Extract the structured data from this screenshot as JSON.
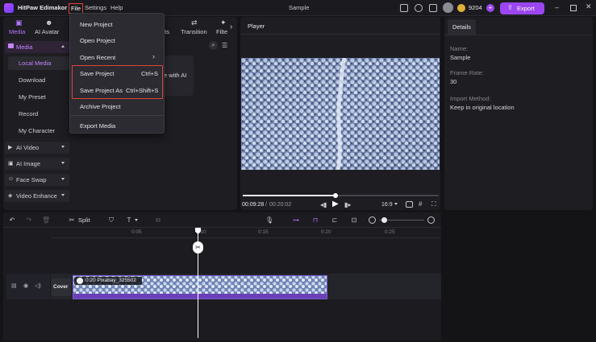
{
  "app": {
    "name": "HitPaw Edimakor",
    "window_title": "Sample",
    "credits": "9204",
    "export_label": "Export"
  },
  "menubar": {
    "file": "File",
    "settings": "Settings",
    "help": "Help"
  },
  "file_menu": {
    "items": [
      {
        "label": "New Project",
        "shortcut": ""
      },
      {
        "label": "Open Project",
        "shortcut": ""
      },
      {
        "label": "Open Recent",
        "shortcut": ""
      },
      {
        "label": "Save Project",
        "shortcut": "Ctrl+S"
      },
      {
        "label": "Save Project As",
        "shortcut": "Ctrl+Shift+S"
      },
      {
        "label": "Archive Project",
        "shortcut": ""
      },
      {
        "label": "Export Media",
        "shortcut": ""
      }
    ]
  },
  "top_tabs": [
    {
      "label": "Media",
      "icon": "media-icon"
    },
    {
      "label": "AI Avatar",
      "icon": "avatar-icon"
    },
    {
      "label": "nts",
      "icon": "elements-icon"
    },
    {
      "label": "Transition",
      "icon": "transition-icon"
    },
    {
      "label": "Filte",
      "icon": "filter-icon"
    }
  ],
  "sidebar": {
    "media_group": "Media",
    "items": [
      "Local Media",
      "Download",
      "My Preset",
      "Record",
      "My Character"
    ],
    "groups": [
      "AI Video",
      "AI Image",
      "Face Swap",
      "Video Enhance"
    ]
  },
  "media_panel": {
    "card_text": "e with AI"
  },
  "player": {
    "title": "Player",
    "current_time": "00:09:28",
    "separator": "/",
    "total_time": "00:20:02",
    "aspect": "16:9",
    "progress": 0.475
  },
  "details": {
    "tab": "Details",
    "fields": [
      {
        "label": "Name:",
        "value": "Sample"
      },
      {
        "label": "Frame Rate:",
        "value": "30"
      },
      {
        "label": "Import Method:",
        "value": "Keep in original location"
      }
    ]
  },
  "timeline": {
    "split_label": "Split",
    "ticks": [
      "0:05",
      "0:10",
      "0:15",
      "0:20",
      "0:25"
    ],
    "cover_label": "Cover",
    "clip_label": "0:20 Pixabay_325502"
  },
  "colors": {
    "accent": "#9b46f0",
    "highlight_box": "#e0443a",
    "clip_bottom": "#6a3fb8"
  }
}
